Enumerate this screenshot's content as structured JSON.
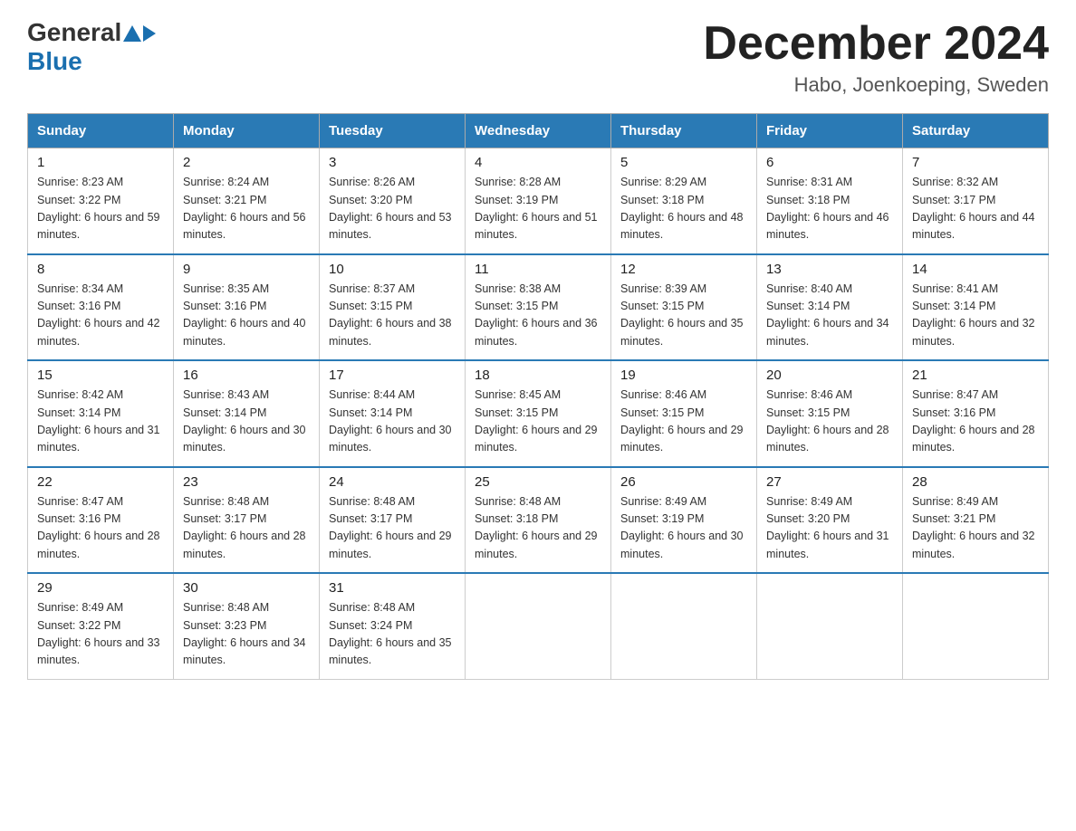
{
  "logo": {
    "general": "General",
    "blue": "Blue"
  },
  "title": "December 2024",
  "location": "Habo, Joenkoeping, Sweden",
  "days_of_week": [
    "Sunday",
    "Monday",
    "Tuesday",
    "Wednesday",
    "Thursday",
    "Friday",
    "Saturday"
  ],
  "weeks": [
    [
      {
        "day": "1",
        "sunrise": "8:23 AM",
        "sunset": "3:22 PM",
        "daylight": "6 hours and 59 minutes."
      },
      {
        "day": "2",
        "sunrise": "8:24 AM",
        "sunset": "3:21 PM",
        "daylight": "6 hours and 56 minutes."
      },
      {
        "day": "3",
        "sunrise": "8:26 AM",
        "sunset": "3:20 PM",
        "daylight": "6 hours and 53 minutes."
      },
      {
        "day": "4",
        "sunrise": "8:28 AM",
        "sunset": "3:19 PM",
        "daylight": "6 hours and 51 minutes."
      },
      {
        "day": "5",
        "sunrise": "8:29 AM",
        "sunset": "3:18 PM",
        "daylight": "6 hours and 48 minutes."
      },
      {
        "day": "6",
        "sunrise": "8:31 AM",
        "sunset": "3:18 PM",
        "daylight": "6 hours and 46 minutes."
      },
      {
        "day": "7",
        "sunrise": "8:32 AM",
        "sunset": "3:17 PM",
        "daylight": "6 hours and 44 minutes."
      }
    ],
    [
      {
        "day": "8",
        "sunrise": "8:34 AM",
        "sunset": "3:16 PM",
        "daylight": "6 hours and 42 minutes."
      },
      {
        "day": "9",
        "sunrise": "8:35 AM",
        "sunset": "3:16 PM",
        "daylight": "6 hours and 40 minutes."
      },
      {
        "day": "10",
        "sunrise": "8:37 AM",
        "sunset": "3:15 PM",
        "daylight": "6 hours and 38 minutes."
      },
      {
        "day": "11",
        "sunrise": "8:38 AM",
        "sunset": "3:15 PM",
        "daylight": "6 hours and 36 minutes."
      },
      {
        "day": "12",
        "sunrise": "8:39 AM",
        "sunset": "3:15 PM",
        "daylight": "6 hours and 35 minutes."
      },
      {
        "day": "13",
        "sunrise": "8:40 AM",
        "sunset": "3:14 PM",
        "daylight": "6 hours and 34 minutes."
      },
      {
        "day": "14",
        "sunrise": "8:41 AM",
        "sunset": "3:14 PM",
        "daylight": "6 hours and 32 minutes."
      }
    ],
    [
      {
        "day": "15",
        "sunrise": "8:42 AM",
        "sunset": "3:14 PM",
        "daylight": "6 hours and 31 minutes."
      },
      {
        "day": "16",
        "sunrise": "8:43 AM",
        "sunset": "3:14 PM",
        "daylight": "6 hours and 30 minutes."
      },
      {
        "day": "17",
        "sunrise": "8:44 AM",
        "sunset": "3:14 PM",
        "daylight": "6 hours and 30 minutes."
      },
      {
        "day": "18",
        "sunrise": "8:45 AM",
        "sunset": "3:15 PM",
        "daylight": "6 hours and 29 minutes."
      },
      {
        "day": "19",
        "sunrise": "8:46 AM",
        "sunset": "3:15 PM",
        "daylight": "6 hours and 29 minutes."
      },
      {
        "day": "20",
        "sunrise": "8:46 AM",
        "sunset": "3:15 PM",
        "daylight": "6 hours and 28 minutes."
      },
      {
        "day": "21",
        "sunrise": "8:47 AM",
        "sunset": "3:16 PM",
        "daylight": "6 hours and 28 minutes."
      }
    ],
    [
      {
        "day": "22",
        "sunrise": "8:47 AM",
        "sunset": "3:16 PM",
        "daylight": "6 hours and 28 minutes."
      },
      {
        "day": "23",
        "sunrise": "8:48 AM",
        "sunset": "3:17 PM",
        "daylight": "6 hours and 28 minutes."
      },
      {
        "day": "24",
        "sunrise": "8:48 AM",
        "sunset": "3:17 PM",
        "daylight": "6 hours and 29 minutes."
      },
      {
        "day": "25",
        "sunrise": "8:48 AM",
        "sunset": "3:18 PM",
        "daylight": "6 hours and 29 minutes."
      },
      {
        "day": "26",
        "sunrise": "8:49 AM",
        "sunset": "3:19 PM",
        "daylight": "6 hours and 30 minutes."
      },
      {
        "day": "27",
        "sunrise": "8:49 AM",
        "sunset": "3:20 PM",
        "daylight": "6 hours and 31 minutes."
      },
      {
        "day": "28",
        "sunrise": "8:49 AM",
        "sunset": "3:21 PM",
        "daylight": "6 hours and 32 minutes."
      }
    ],
    [
      {
        "day": "29",
        "sunrise": "8:49 AM",
        "sunset": "3:22 PM",
        "daylight": "6 hours and 33 minutes."
      },
      {
        "day": "30",
        "sunrise": "8:48 AM",
        "sunset": "3:23 PM",
        "daylight": "6 hours and 34 minutes."
      },
      {
        "day": "31",
        "sunrise": "8:48 AM",
        "sunset": "3:24 PM",
        "daylight": "6 hours and 35 minutes."
      },
      null,
      null,
      null,
      null
    ]
  ]
}
